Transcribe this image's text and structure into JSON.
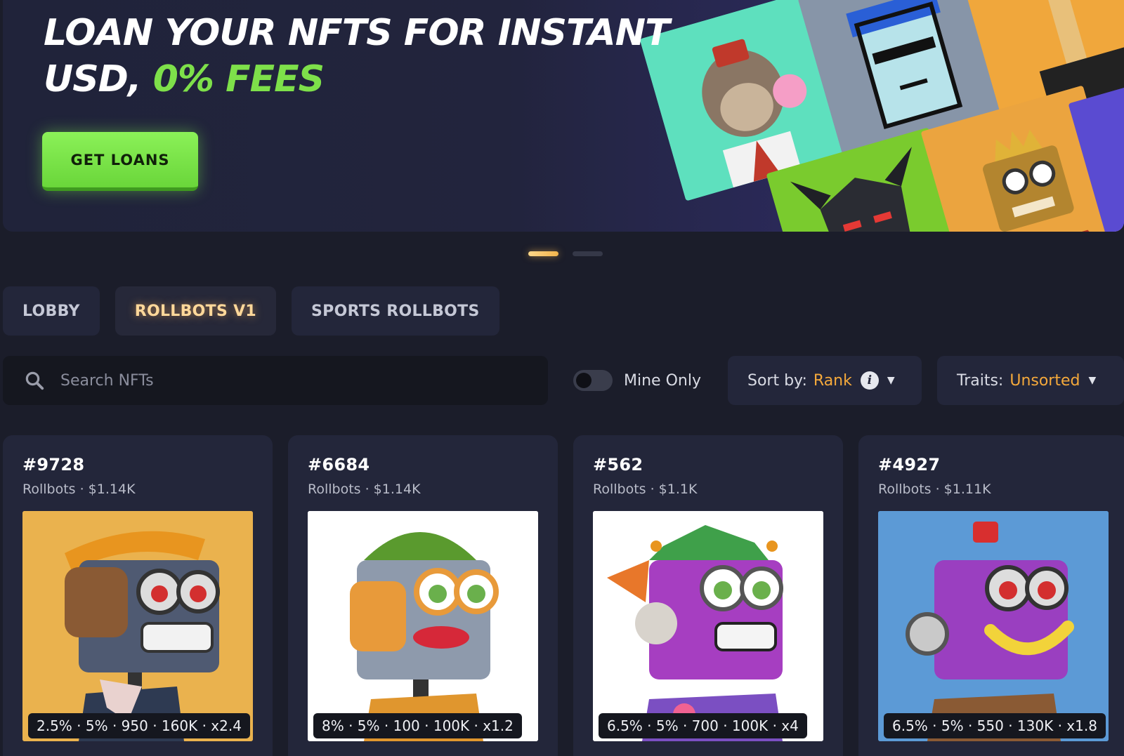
{
  "hero": {
    "title_line1": "LOAN YOUR NFTS FOR INSTANT",
    "title_line2_prefix": "USD, ",
    "title_line2_accent": "0% FEES",
    "cta_label": "GET LOANS",
    "colors": {
      "accent_green": "#7ee04a",
      "background": "#20233a"
    },
    "collage_icons": [
      "ape-nft-image",
      "punk-nft-image",
      "giraffe-nft-image",
      "demon-nft-image",
      "crown-robot-nft-image",
      "purple-nft-image"
    ]
  },
  "carousel": {
    "slides": 2,
    "active": 0
  },
  "tabs": [
    {
      "label": "LOBBY",
      "active": false
    },
    {
      "label": "ROLLBOTS V1",
      "active": true
    },
    {
      "label": "SPORTS ROLLBOTS",
      "active": false
    }
  ],
  "filters": {
    "search_placeholder": "Search NFTs",
    "mine_only_label": "Mine Only",
    "mine_only_on": false,
    "sort_label": "Sort by:",
    "sort_value": "Rank",
    "traits_label": "Traits:",
    "traits_value": "Unsorted",
    "accent_orange": "#f5a93b"
  },
  "cards": [
    {
      "id": "#9728",
      "subtitle": "Rollbots · $1.14K",
      "stats": "2.5% · 5% · 950 · 160K · x2.4",
      "bg": "#eab24e"
    },
    {
      "id": "#6684",
      "subtitle": "Rollbots · $1.14K",
      "stats": "8% · 5% · 100 · 100K · x1.2",
      "bg": "#ffffff"
    },
    {
      "id": "#562",
      "subtitle": "Rollbots · $1.1K",
      "stats": "6.5% · 5% · 700 · 100K · x4",
      "bg": "#ffffff"
    },
    {
      "id": "#4927",
      "subtitle": "Rollbots · $1.11K",
      "stats": "6.5% · 5% · 550 · 130K · x1.8",
      "bg": "#5c9ad6"
    }
  ]
}
